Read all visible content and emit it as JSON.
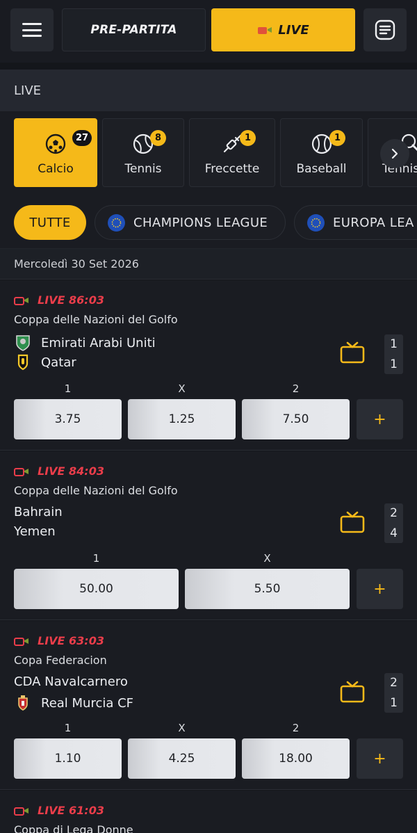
{
  "header": {
    "pre_label": "PRE-PARTITA",
    "live_label": "LIVE"
  },
  "section": {
    "title": "LIVE"
  },
  "sports": [
    {
      "label": "Calcio",
      "count": "27",
      "icon": "soccer-ball-icon"
    },
    {
      "label": "Tennis",
      "count": "8",
      "icon": "tennis-ball-icon"
    },
    {
      "label": "Freccette",
      "count": "1",
      "icon": "dart-icon"
    },
    {
      "label": "Baseball",
      "count": "1",
      "icon": "baseball-icon"
    },
    {
      "label": "Tennis",
      "count": "",
      "icon": "table-tennis-icon"
    }
  ],
  "leagues": {
    "all_label": "TUTTE",
    "items": [
      {
        "label": "CHAMPIONS LEAGUE"
      },
      {
        "label": "EUROPA LEA"
      }
    ]
  },
  "date": "Mercoledì 30 Set 2026",
  "events": [
    {
      "status": "LIVE 86:03",
      "competition": "Coppa delle Nazioni del Golfo",
      "home": "Emirati Arabi Uniti",
      "away": "Qatar",
      "score_home": "1",
      "score_away": "1",
      "odds": [
        {
          "label": "1",
          "value": "3.75"
        },
        {
          "label": "X",
          "value": "1.25"
        },
        {
          "label": "2",
          "value": "7.50"
        }
      ]
    },
    {
      "status": "LIVE 84:03",
      "competition": "Coppa delle Nazioni del Golfo",
      "home": "Bahrain",
      "away": "Yemen",
      "score_home": "2",
      "score_away": "4",
      "odds": [
        {
          "label": "1",
          "value": "50.00"
        },
        {
          "label": "X",
          "value": "5.50"
        }
      ]
    },
    {
      "status": "LIVE 63:03",
      "competition": "Copa Federacion",
      "home": "CDA Navalcarnero",
      "away": "Real Murcia CF",
      "score_home": "2",
      "score_away": "1",
      "odds": [
        {
          "label": "1",
          "value": "1.10"
        },
        {
          "label": "X",
          "value": "4.25"
        },
        {
          "label": "2",
          "value": "18.00"
        }
      ]
    },
    {
      "status": "LIVE 61:03",
      "competition": "Coppa di Lega Donne"
    }
  ],
  "more_label": "+",
  "colors": {
    "accent": "#f5b919",
    "live_red": "#ea3d4a",
    "background": "#14161b"
  }
}
